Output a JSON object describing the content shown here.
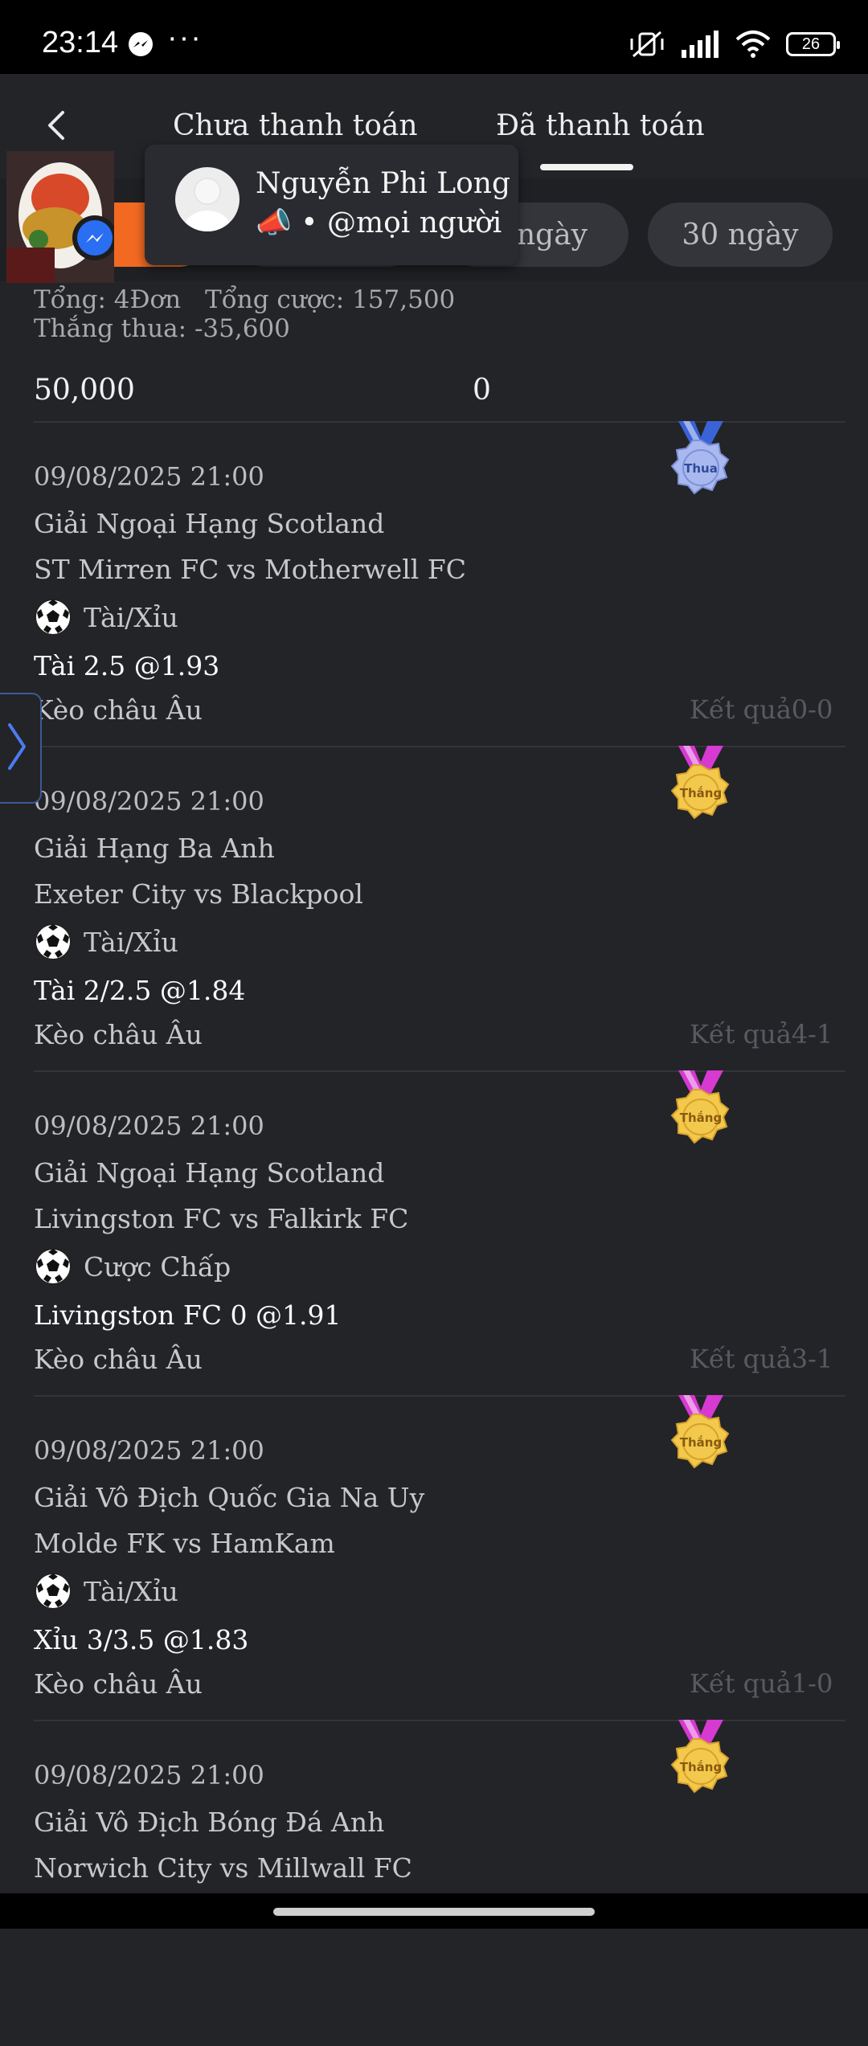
{
  "status_bar": {
    "time": "23:14",
    "dots": "···",
    "battery": "26"
  },
  "header": {
    "tab_unpaid": "Chưa thanh toán",
    "tab_paid": "Đã thanh toán",
    "active_tab": "paid"
  },
  "filters": [
    {
      "label": "",
      "active": true
    },
    {
      "label": "",
      "active": false
    },
    {
      "label": "ngày",
      "active": false
    },
    {
      "label": "30 ngày",
      "active": false
    }
  ],
  "chat_bubble": {
    "name": "Nguyễn Phi Long",
    "subtitle": "📣 • @mọi người"
  },
  "summary": {
    "total": "Tổng: 4Đơn",
    "total_bet": "Tổng cược: 157,500",
    "win_loss": "Thắng thua: -35,600"
  },
  "amounts": {
    "left": "50,000",
    "right": "0"
  },
  "bets": [
    {
      "datetime": "09/08/2025 21:00",
      "league": "Giải Ngoại Hạng Scotland",
      "match": "ST Mirren FC vs Motherwell FC",
      "market": "Tài/Xỉu",
      "selection": "Tài 2.5 @1.93",
      "odds_type": "Kèo châu Âu",
      "result": "Kết quả0-0",
      "status": "Thua"
    },
    {
      "datetime": "09/08/2025 21:00",
      "league": "Giải Hạng Ba Anh",
      "match": "Exeter City vs Blackpool",
      "market": "Tài/Xỉu",
      "selection": "Tài 2/2.5 @1.84",
      "odds_type": "Kèo châu Âu",
      "result": "Kết quả4-1",
      "status": "Thắng"
    },
    {
      "datetime": "09/08/2025 21:00",
      "league": "Giải Ngoại Hạng Scotland",
      "match": "Livingston FC vs Falkirk FC",
      "market": "Cược Chấp",
      "selection": "Livingston FC 0 @1.91",
      "odds_type": "Kèo châu Âu",
      "result": "Kết quả3-1",
      "status": "Thắng"
    },
    {
      "datetime": "09/08/2025 21:00",
      "league": "Giải Vô Địch Quốc Gia Na Uy",
      "match": "Molde FK vs HamKam",
      "market": "Tài/Xỉu",
      "selection": "Xỉu 3/3.5 @1.83",
      "odds_type": "Kèo châu Âu",
      "result": "Kết quả1-0",
      "status": "Thắng"
    },
    {
      "datetime": "09/08/2025 21:00",
      "league": "Giải Vô Địch Bóng Đá Anh",
      "match": "Norwich City vs Millwall FC",
      "market": "",
      "selection": "",
      "odds_type": "",
      "result": "",
      "status": "Thắng"
    }
  ],
  "colors": {
    "accent": "#f26a21",
    "background": "#232428",
    "win_ribbon": "#d63ad1",
    "loss_ribbon": "#3a63d6"
  }
}
